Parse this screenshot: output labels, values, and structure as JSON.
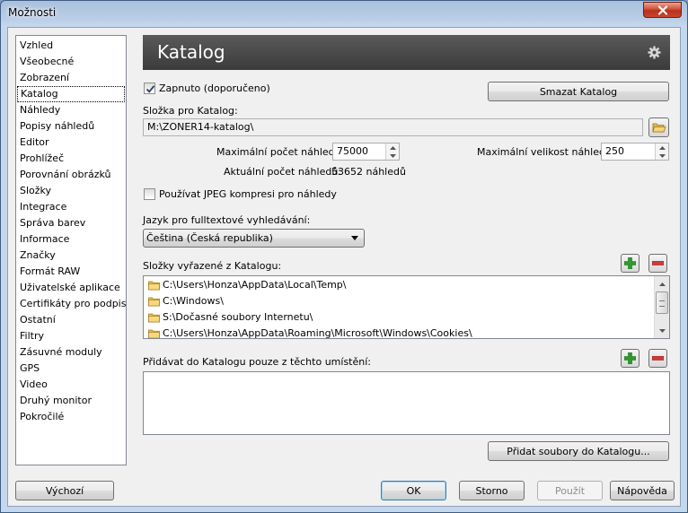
{
  "window": {
    "title": "Možnosti"
  },
  "sidebar": {
    "items": [
      "Vzhled",
      "Všeobecné",
      "Zobrazení",
      "Katalog",
      "Náhledy",
      "Popisy náhledů",
      "Editor",
      "Prohlížeč",
      "Porovnání obrázků",
      "Složky",
      "Integrace",
      "Správa barev",
      "Informace",
      "Značky",
      "Formát RAW",
      "Uživatelské aplikace",
      "Certifikáty pro podpis",
      "Ostatní",
      "Filtry",
      "Zásuvné moduly",
      "GPS",
      "Video",
      "Druhý monitor",
      "Pokročilé"
    ],
    "selected_index": 3
  },
  "header": {
    "title": "Katalog",
    "icon": "gear-icon"
  },
  "catalog": {
    "enabled_label": "Zapnuto (doporučeno)",
    "enabled_checked": true,
    "delete_button": "Smazat Katalog",
    "folder_label": "Složka pro Katalog:",
    "folder_value": "M:\\ZONER14-katalog\\",
    "max_previews_label": "Maximální počet náhledů:",
    "max_previews_value": "75000",
    "max_size_label": "Maximální velikost náhledů:",
    "max_size_value": "250",
    "current_previews_label": "Aktuální počet náhledů:",
    "current_previews_value": "53652 náhledů",
    "jpeg_label": "Používat JPEG kompresi pro náhledy",
    "jpeg_checked": false,
    "language_label": "Jazyk pro fulltextové vyhledávání:",
    "language_value": "Čeština (Česká republika)",
    "excluded_label": "Složky vyřazené z Katalogu:",
    "excluded_folders": [
      "C:\\Users\\Honza\\AppData\\Local\\Temp\\",
      "C:\\Windows\\",
      "S:\\Dočasné soubory Internetu\\",
      "C:\\Users\\Honza\\AppData\\Roaming\\Microsoft\\Windows\\Cookies\\"
    ],
    "include_label": "Přidávat do Katalogu pouze z těchto umístění:",
    "add_files_button": "Přidat soubory do Katalogu..."
  },
  "footer": {
    "default_button": "Výchozí",
    "ok_button": "OK",
    "cancel_button": "Storno",
    "apply_button": "Použít",
    "help_button": "Nápověda"
  },
  "colors": {
    "header_bg": "#464646",
    "add": "#2e9a2e",
    "remove": "#d03a3a",
    "close": "#c7452f"
  }
}
